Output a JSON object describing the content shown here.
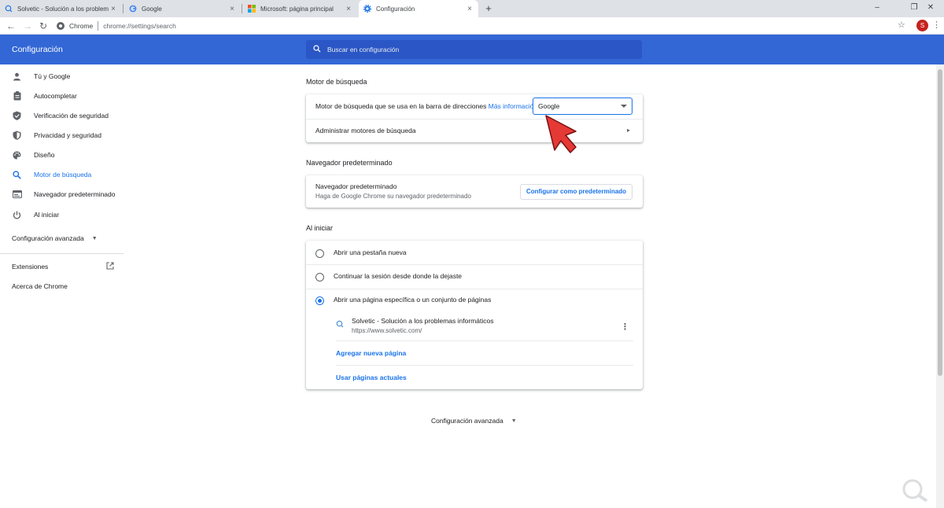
{
  "tabs": [
    {
      "title": "Solvetic - Solución a los problem",
      "icon": "solvetic-icon"
    },
    {
      "title": "Google",
      "icon": "google-icon"
    },
    {
      "title": "Microsoft: página principal",
      "icon": "microsoft-icon"
    },
    {
      "title": "Configuración",
      "icon": "gear-icon",
      "active": true
    }
  ],
  "toolbar": {
    "site_label": "Chrome",
    "url": "chrome://settings/search",
    "avatar_letter": "S"
  },
  "header": {
    "title": "Configuración",
    "search_placeholder": "Buscar en configuración"
  },
  "sidebar": {
    "items": [
      {
        "label": "Tú y Google",
        "icon": "person-icon"
      },
      {
        "label": "Autocompletar",
        "icon": "clipboard-icon"
      },
      {
        "label": "Verificación de seguridad",
        "icon": "shield-check-icon"
      },
      {
        "label": "Privacidad y seguridad",
        "icon": "shield-icon"
      },
      {
        "label": "Diseño",
        "icon": "palette-icon"
      },
      {
        "label": "Motor de búsqueda",
        "icon": "search-icon",
        "active": true
      },
      {
        "label": "Navegador predeterminado",
        "icon": "browser-icon"
      },
      {
        "label": "Al iniciar",
        "icon": "power-icon"
      }
    ],
    "advanced": "Configuración avanzada",
    "extensions": "Extensiones",
    "about": "Acerca de Chrome"
  },
  "search_engine": {
    "section_title": "Motor de búsqueda",
    "row_label": "Motor de búsqueda que se usa en la barra de direcciones",
    "more_info": "Más información",
    "selected": "Google",
    "manage": "Administrar motores de búsqueda"
  },
  "default_browser": {
    "section_title": "Navegador predeterminado",
    "title": "Navegador predeterminado",
    "subtitle": "Haga de Google Chrome su navegador predeterminado",
    "button": "Configurar como predeterminado"
  },
  "on_startup": {
    "section_title": "Al iniciar",
    "options": [
      {
        "label": "Abrir una pestaña nueva",
        "checked": false
      },
      {
        "label": "Continuar la sesión desde donde la dejaste",
        "checked": false
      },
      {
        "label": "Abrir una página específica o un conjunto de páginas",
        "checked": true
      }
    ],
    "page": {
      "title": "Solvetic - Solución a los problemas informáticos",
      "url": "https://www.solvetic.com/"
    },
    "add_page": "Agregar nueva página",
    "use_current": "Usar páginas actuales"
  },
  "bottom": {
    "advanced": "Configuración avanzada"
  },
  "colors": {
    "header": "#3367d6",
    "accent": "#1a73e8",
    "pointer": "#e53935"
  }
}
